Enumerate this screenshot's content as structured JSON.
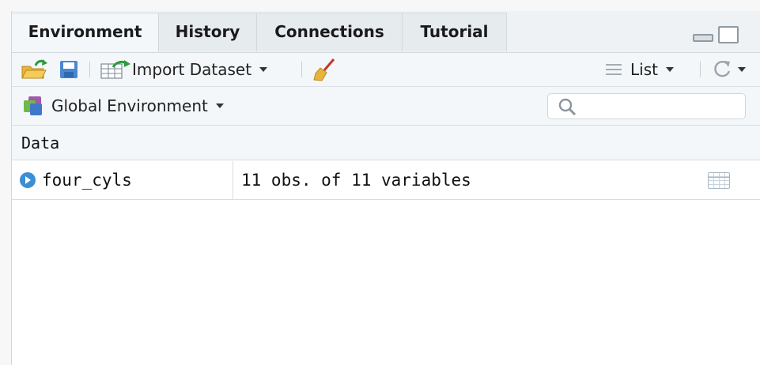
{
  "tabs": [
    {
      "label": "Environment",
      "active": true
    },
    {
      "label": "History",
      "active": false
    },
    {
      "label": "Connections",
      "active": false
    },
    {
      "label": "Tutorial",
      "active": false
    }
  ],
  "toolbar": {
    "import_dataset_label": "Import Dataset",
    "view_mode_label": "List",
    "icons": [
      "open-folder-icon",
      "save-icon",
      "import-dataset-icon",
      "broom-icon",
      "list-icon",
      "refresh-icon"
    ]
  },
  "environment": {
    "scope_label": "Global Environment",
    "search_placeholder": ""
  },
  "data_section": {
    "header": "Data",
    "rows": [
      {
        "name": "four_cyls",
        "value": "11 obs. of 11 variables"
      }
    ]
  },
  "colors": {
    "accent_blue": "#3a8fd6",
    "toolbar_bg": "#f3f7fa",
    "tab_bg": "#e6ebee"
  }
}
